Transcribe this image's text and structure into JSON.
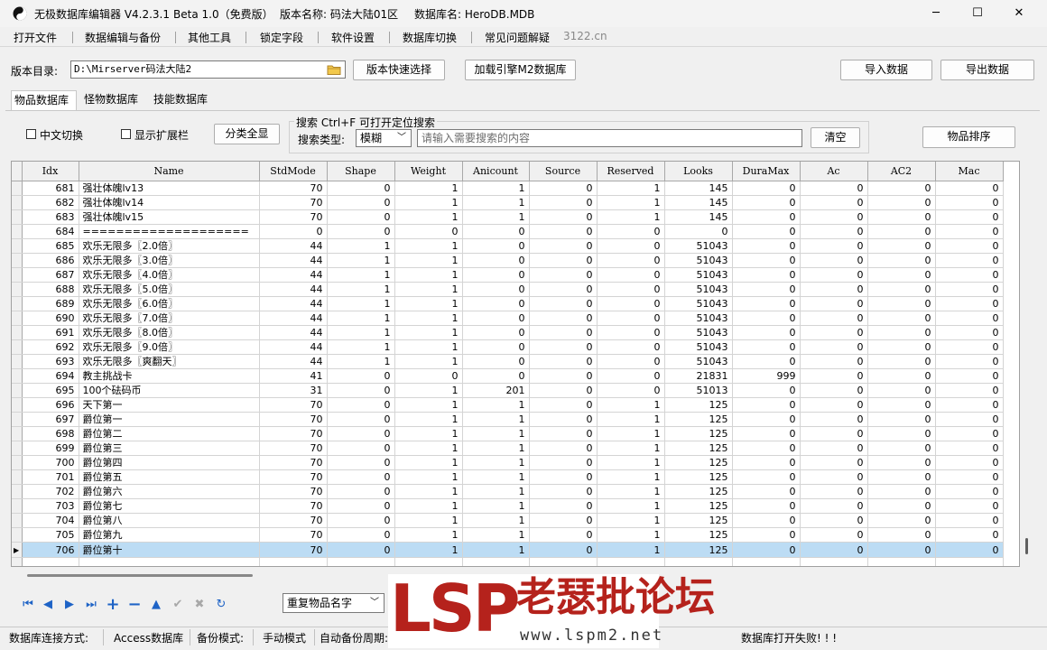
{
  "window": {
    "app_title": "无极数据库编辑器 V4.2.3.1",
    "beta": "Beta 1.0（免费版）",
    "version_label": "版本名称: 码法大陆01区",
    "db_label": "数据库名: HeroDB.MDB",
    "controls": {
      "minimize": "─",
      "maximize": "☐",
      "close": "✕"
    }
  },
  "menu": {
    "items": [
      "打开文件",
      "数据编辑与备份",
      "其他工具",
      "锁定字段",
      "软件设置",
      "数据库切换",
      "常见问题解疑"
    ],
    "site": "3122.cn"
  },
  "toolbar": {
    "dir_label": "版本目录:",
    "dir_value": "D:\\Mirserver码法大陆2",
    "quick_select": "版本快速选择",
    "load_engine": "加载引擎M2数据库",
    "import": "导入数据",
    "export": "导出数据"
  },
  "tabs": [
    "物品数据库",
    "怪物数据库",
    "技能数据库"
  ],
  "options": {
    "chinese_switch": "中文切换",
    "show_ext": "显示扩展栏",
    "show_all": "分类全显",
    "sort": "物品排序"
  },
  "search": {
    "title": "搜索  Ctrl+F 可打开定位搜索",
    "type_label": "搜索类型:",
    "type_value": "模糊",
    "placeholder": "请输入需要搜索的内容",
    "clear": "清空"
  },
  "grid": {
    "columns": [
      "Idx",
      "Name",
      "StdMode",
      "Shape",
      "Weight",
      "Anicount",
      "Source",
      "Reserved",
      "Looks",
      "DuraMax",
      "Ac",
      "AC2",
      "Mac"
    ],
    "rows": [
      [
        "681",
        "强壮体魄lv13",
        "70",
        "0",
        "1",
        "1",
        "0",
        "1",
        "145",
        "0",
        "0",
        "0",
        "0"
      ],
      [
        "682",
        "强壮体魄lv14",
        "70",
        "0",
        "1",
        "1",
        "0",
        "1",
        "145",
        "0",
        "0",
        "0",
        "0"
      ],
      [
        "683",
        "强壮体魄lv15",
        "70",
        "0",
        "1",
        "1",
        "0",
        "1",
        "145",
        "0",
        "0",
        "0",
        "0"
      ],
      [
        "684",
        "====================",
        "0",
        "0",
        "0",
        "0",
        "0",
        "0",
        "0",
        "0",
        "0",
        "0",
        "0"
      ],
      [
        "685",
        "欢乐无限多〖2.0倍〗",
        "44",
        "1",
        "1",
        "0",
        "0",
        "0",
        "51043",
        "0",
        "0",
        "0",
        "0"
      ],
      [
        "686",
        "欢乐无限多〖3.0倍〗",
        "44",
        "1",
        "1",
        "0",
        "0",
        "0",
        "51043",
        "0",
        "0",
        "0",
        "0"
      ],
      [
        "687",
        "欢乐无限多〖4.0倍〗",
        "44",
        "1",
        "1",
        "0",
        "0",
        "0",
        "51043",
        "0",
        "0",
        "0",
        "0"
      ],
      [
        "688",
        "欢乐无限多〖5.0倍〗",
        "44",
        "1",
        "1",
        "0",
        "0",
        "0",
        "51043",
        "0",
        "0",
        "0",
        "0"
      ],
      [
        "689",
        "欢乐无限多〖6.0倍〗",
        "44",
        "1",
        "1",
        "0",
        "0",
        "0",
        "51043",
        "0",
        "0",
        "0",
        "0"
      ],
      [
        "690",
        "欢乐无限多〖7.0倍〗",
        "44",
        "1",
        "1",
        "0",
        "0",
        "0",
        "51043",
        "0",
        "0",
        "0",
        "0"
      ],
      [
        "691",
        "欢乐无限多〖8.0倍〗",
        "44",
        "1",
        "1",
        "0",
        "0",
        "0",
        "51043",
        "0",
        "0",
        "0",
        "0"
      ],
      [
        "692",
        "欢乐无限多〖9.0倍〗",
        "44",
        "1",
        "1",
        "0",
        "0",
        "0",
        "51043",
        "0",
        "0",
        "0",
        "0"
      ],
      [
        "693",
        "欢乐无限多〖爽翻天〗",
        "44",
        "1",
        "1",
        "0",
        "0",
        "0",
        "51043",
        "0",
        "0",
        "0",
        "0"
      ],
      [
        "694",
        "教主挑战卡",
        "41",
        "0",
        "0",
        "0",
        "0",
        "0",
        "21831",
        "999",
        "0",
        "0",
        "0"
      ],
      [
        "695",
        "100个砝码币",
        "31",
        "0",
        "1",
        "201",
        "0",
        "0",
        "51013",
        "0",
        "0",
        "0",
        "0"
      ],
      [
        "696",
        "天下第一",
        "70",
        "0",
        "1",
        "1",
        "0",
        "1",
        "125",
        "0",
        "0",
        "0",
        "0"
      ],
      [
        "697",
        "爵位第一",
        "70",
        "0",
        "1",
        "1",
        "0",
        "1",
        "125",
        "0",
        "0",
        "0",
        "0"
      ],
      [
        "698",
        "爵位第二",
        "70",
        "0",
        "1",
        "1",
        "0",
        "1",
        "125",
        "0",
        "0",
        "0",
        "0"
      ],
      [
        "699",
        "爵位第三",
        "70",
        "0",
        "1",
        "1",
        "0",
        "1",
        "125",
        "0",
        "0",
        "0",
        "0"
      ],
      [
        "700",
        "爵位第四",
        "70",
        "0",
        "1",
        "1",
        "0",
        "1",
        "125",
        "0",
        "0",
        "0",
        "0"
      ],
      [
        "701",
        "爵位第五",
        "70",
        "0",
        "1",
        "1",
        "0",
        "1",
        "125",
        "0",
        "0",
        "0",
        "0"
      ],
      [
        "702",
        "爵位第六",
        "70",
        "0",
        "1",
        "1",
        "0",
        "1",
        "125",
        "0",
        "0",
        "0",
        "0"
      ],
      [
        "703",
        "爵位第七",
        "70",
        "0",
        "1",
        "1",
        "0",
        "1",
        "125",
        "0",
        "0",
        "0",
        "0"
      ],
      [
        "704",
        "爵位第八",
        "70",
        "0",
        "1",
        "1",
        "0",
        "1",
        "125",
        "0",
        "0",
        "0",
        "0"
      ],
      [
        "705",
        "爵位第九",
        "70",
        "0",
        "1",
        "1",
        "0",
        "1",
        "125",
        "0",
        "0",
        "0",
        "0"
      ],
      [
        "706",
        "爵位第十",
        "70",
        "0",
        "1",
        "1",
        "0",
        "1",
        "125",
        "0",
        "0",
        "0",
        "0"
      ]
    ],
    "selected_idx": "706"
  },
  "navigator": {
    "icons": [
      "first-icon",
      "prior-icon",
      "next-icon",
      "last-icon",
      "insert-icon",
      "delete-icon",
      "edit-icon",
      "post-icon",
      "cancel-icon",
      "refresh-icon"
    ],
    "dup_value": "重复物品名字"
  },
  "watermark": {
    "brand": "LSP",
    "forum": "老瑟批论坛",
    "url": "www.lspm2.net"
  },
  "status": {
    "conn_label": "数据库连接方式:",
    "conn_value": "Access数据库",
    "backup_label": "备份模式:",
    "backup_value": "手动模式",
    "auto_label": "自动备份周期:",
    "message": "数据库打开失败! ! !"
  },
  "colors": {
    "selection": "#bcdcf4",
    "watermark_red": "#b5221c",
    "nav_blue": "#1e63c6"
  }
}
